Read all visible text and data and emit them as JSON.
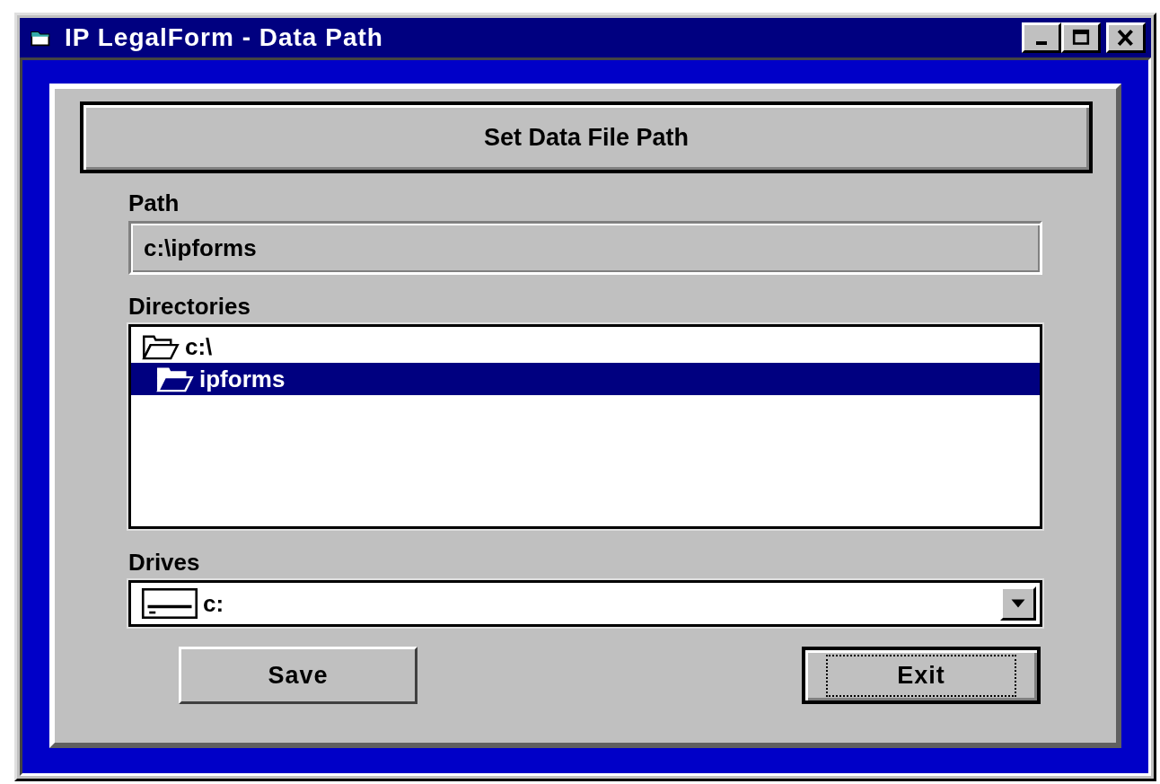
{
  "window": {
    "title": "IP LegalForm - Data Path"
  },
  "header": {
    "label": "Set Data File Path"
  },
  "path": {
    "label": "Path",
    "value": "c:\\ipforms"
  },
  "directories": {
    "label": "Directories",
    "items": [
      {
        "label": "c:\\",
        "selected": false,
        "children": [
          {
            "label": "ipforms",
            "selected": true
          }
        ]
      }
    ]
  },
  "drives": {
    "label": "Drives",
    "value": "c:"
  },
  "buttons": [
    {
      "label": "Save",
      "focused": false
    },
    {
      "label": "Exit",
      "focused": true
    }
  ]
}
